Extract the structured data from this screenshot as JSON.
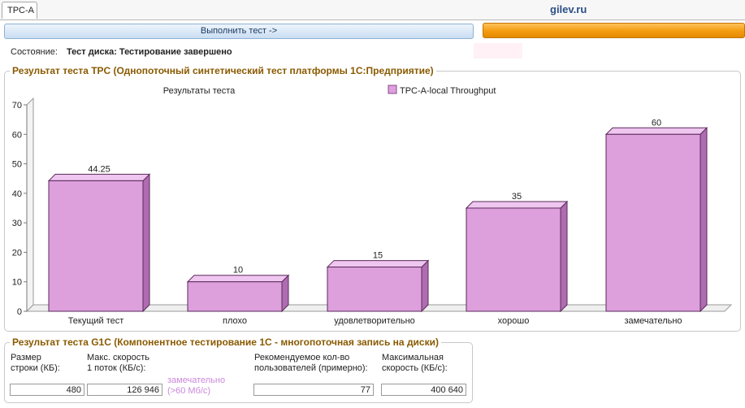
{
  "tab": {
    "label": "TPC-A"
  },
  "site": "gilev.ru",
  "run_button": {
    "label": "Выполнить тест ->"
  },
  "progress": {
    "fraction": 1.0
  },
  "status": {
    "label": "Состояние:",
    "value": "Тест диска: Тестирование завершено"
  },
  "tpc_section": {
    "legend": "Результат теста TPC (Однопоточный синтетический тест платформы 1С:Предприятие)"
  },
  "chart_data": {
    "type": "bar",
    "title": "Результаты теста",
    "categories": [
      "Текущий тест",
      "плохо",
      "удовлетворительно",
      "хорошо",
      "замечательно"
    ],
    "series": [
      {
        "name": "TPC-A-local Throughput",
        "values": [
          44.25,
          10,
          15,
          35,
          60
        ]
      }
    ],
    "value_labels": [
      "44.25",
      "10",
      "15",
      "35",
      "60"
    ],
    "ylim": [
      0,
      70
    ],
    "yticks": [
      0,
      10,
      20,
      30,
      40,
      50,
      60,
      70
    ],
    "grid": false,
    "legend_position": "top-right",
    "bar_color": "#dda0dd"
  },
  "g1c_section": {
    "legend": "Результат теста G1C (Компонентное тестирование 1С - многопоточная запись на диски)",
    "row_size": {
      "label_line1": "Размер",
      "label_line2": "строки (КБ):",
      "value": "480"
    },
    "max_speed_1": {
      "label_line1": "Макс. скорость",
      "label_line2": "1 поток (КБ/с):",
      "value": "126 946"
    },
    "hint": {
      "line1": "замечательно",
      "line2": "(>60 Мб/с)"
    },
    "rec_users": {
      "label_line1": "Рекомендуемое кол-во",
      "label_line2": "пользователей (примерно):",
      "value": "77"
    },
    "max_speed": {
      "label_line1": "Максимальная",
      "label_line2": "скорость (КБ/с):",
      "value": "400 640"
    }
  }
}
